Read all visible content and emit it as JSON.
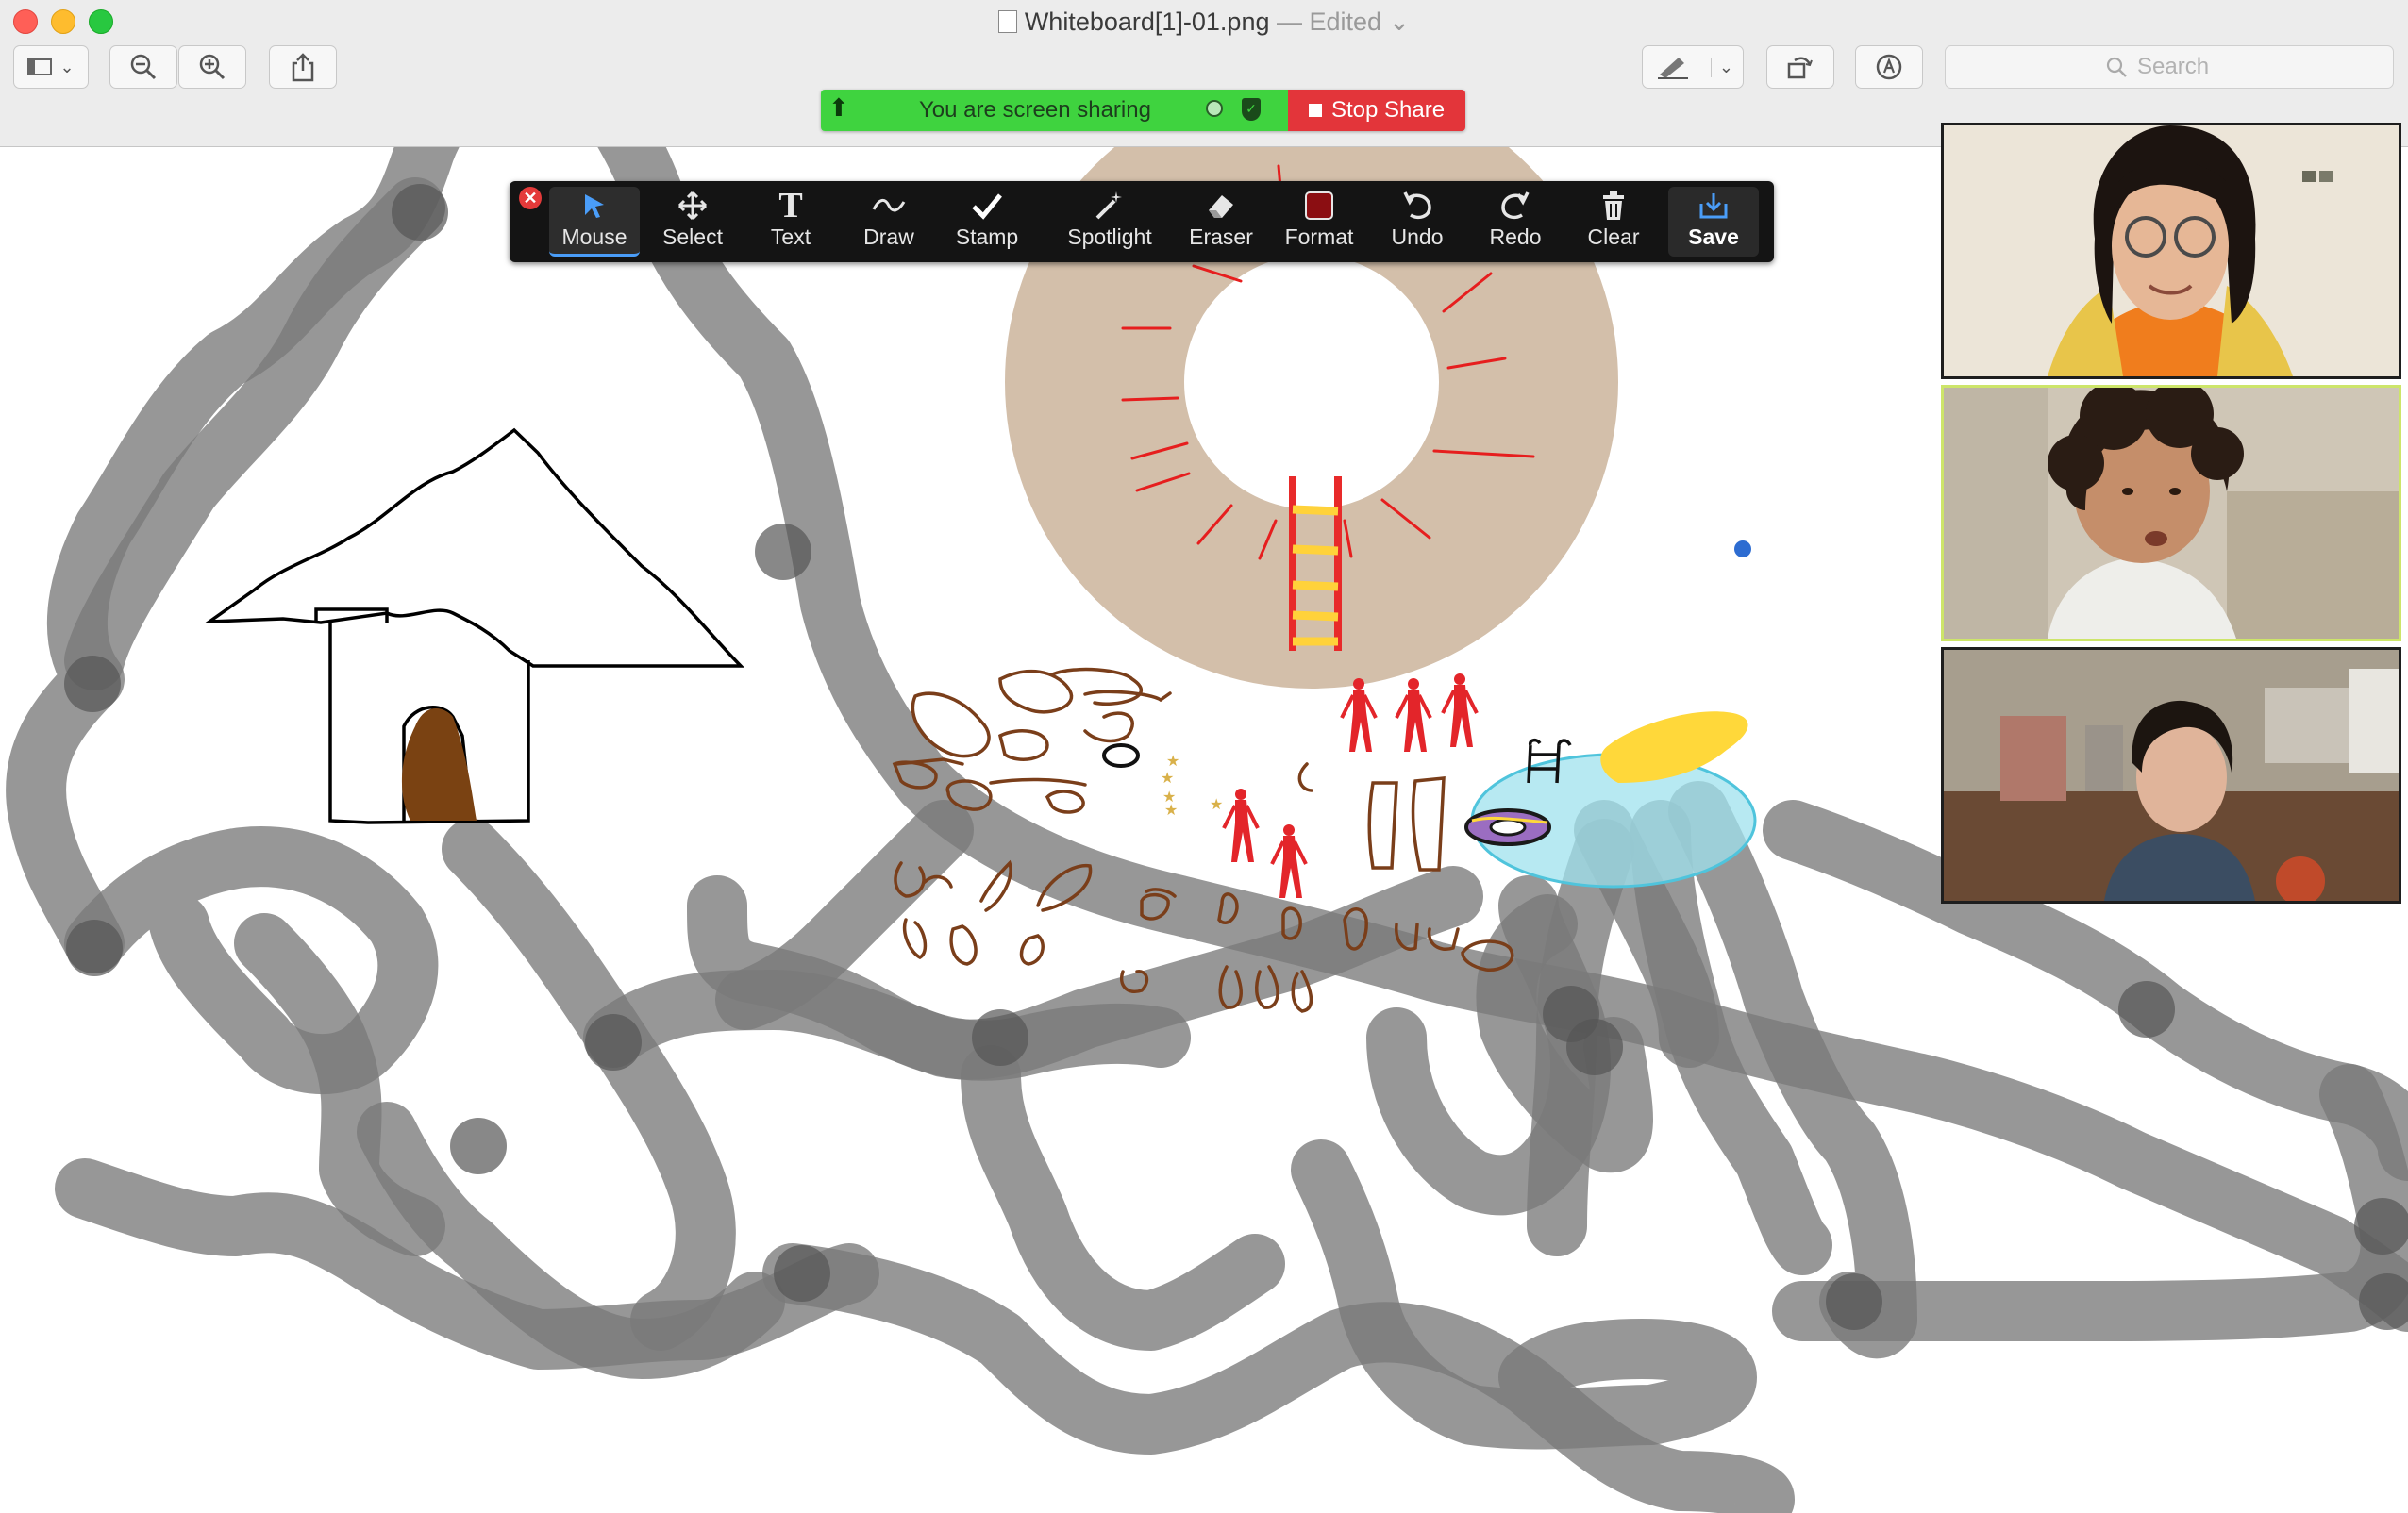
{
  "window": {
    "title": "Whiteboard[1]-01.png",
    "title_suffix": "— Edited",
    "traffic_colors": [
      "#ff5f57",
      "#febc2e",
      "#28c840"
    ]
  },
  "toolbar": {
    "search_placeholder": "Search"
  },
  "share_bar": {
    "status_text": "You are screen sharing",
    "stop_label": "Stop Share",
    "green": "#3fd33f",
    "red": "#e3353a"
  },
  "annotation_toolbar": {
    "tools": [
      {
        "label": "Mouse",
        "icon": "cursor-arrow-icon"
      },
      {
        "label": "Select",
        "icon": "move-arrows-icon"
      },
      {
        "label": "Text",
        "icon": "text-t-icon"
      },
      {
        "label": "Draw",
        "icon": "squiggle-icon"
      },
      {
        "label": "Stamp",
        "icon": "checkmark-icon"
      },
      {
        "label": "Spotlight",
        "icon": "magic-wand-icon"
      },
      {
        "label": "Eraser",
        "icon": "eraser-icon"
      },
      {
        "label": "Format",
        "icon": "color-swatch-icon"
      },
      {
        "label": "Undo",
        "icon": "undo-arrow-icon"
      },
      {
        "label": "Redo",
        "icon": "redo-arrow-icon"
      },
      {
        "label": "Clear",
        "icon": "trash-icon"
      },
      {
        "label": "Save",
        "icon": "save-download-icon"
      }
    ],
    "active": "Mouse",
    "format_color": "#8b0e12"
  },
  "participants": [
    {
      "highlight": false
    },
    {
      "highlight": true
    },
    {
      "highlight": false
    }
  ]
}
